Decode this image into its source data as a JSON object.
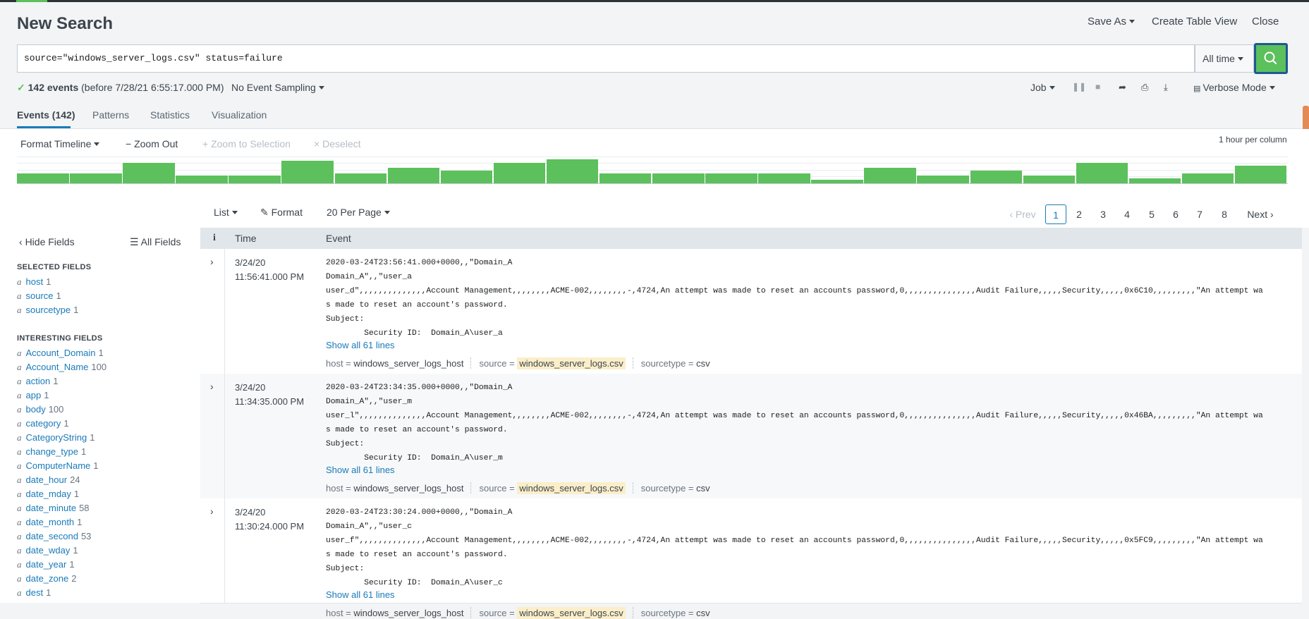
{
  "header": {
    "title": "New Search",
    "save_as": "Save As",
    "create_table_view": "Create Table View",
    "close": "Close"
  },
  "search": {
    "query": "source=\"windows_server_logs.csv\" status=failure",
    "time_range": "All time"
  },
  "status": {
    "events_count": "142 events",
    "before": "(before 7/28/21 6:55:17.000 PM)",
    "sampling": "No Event Sampling",
    "job": "Job",
    "mode": "Verbose Mode"
  },
  "tabs": [
    {
      "label": "Events (142)"
    },
    {
      "label": "Patterns"
    },
    {
      "label": "Statistics"
    },
    {
      "label": "Visualization"
    }
  ],
  "timeline": {
    "format": "Format Timeline",
    "zoom_out": "Zoom Out",
    "zoom_selection": "Zoom to Selection",
    "deselect": "Deselect",
    "scale": "1 hour per column",
    "bar_levels": [
      0.4,
      0.4,
      0.8,
      0.3,
      0.3,
      0.9,
      0.4,
      0.6,
      0.5,
      0.8,
      0.95,
      0.4,
      0.4,
      0.4,
      0.4,
      0.15,
      0.6,
      0.3,
      0.5,
      0.3,
      0.8,
      0.2,
      0.4,
      0.7
    ]
  },
  "results_toolbar": {
    "list": "List",
    "format": "Format",
    "per_page": "20 Per Page",
    "prev": "Prev",
    "next": "Next",
    "pages": [
      "1",
      "2",
      "3",
      "4",
      "5",
      "6",
      "7",
      "8"
    ]
  },
  "sidebar": {
    "hide_fields": "Hide Fields",
    "all_fields": "All Fields",
    "selected_title": "SELECTED FIELDS",
    "selected": [
      {
        "name": "host",
        "count": "1"
      },
      {
        "name": "source",
        "count": "1"
      },
      {
        "name": "sourcetype",
        "count": "1"
      }
    ],
    "interesting_title": "INTERESTING FIELDS",
    "interesting": [
      {
        "name": "Account_Domain",
        "count": "1"
      },
      {
        "name": "Account_Name",
        "count": "100"
      },
      {
        "name": "action",
        "count": "1"
      },
      {
        "name": "app",
        "count": "1"
      },
      {
        "name": "body",
        "count": "100"
      },
      {
        "name": "category",
        "count": "1"
      },
      {
        "name": "CategoryString",
        "count": "1"
      },
      {
        "name": "change_type",
        "count": "1"
      },
      {
        "name": "ComputerName",
        "count": "1"
      },
      {
        "name": "date_hour",
        "count": "24"
      },
      {
        "name": "date_mday",
        "count": "1"
      },
      {
        "name": "date_minute",
        "count": "58"
      },
      {
        "name": "date_month",
        "count": "1"
      },
      {
        "name": "date_second",
        "count": "53"
      },
      {
        "name": "date_wday",
        "count": "1"
      },
      {
        "name": "date_year",
        "count": "1"
      },
      {
        "name": "date_zone",
        "count": "2"
      },
      {
        "name": "dest",
        "count": "1"
      }
    ]
  },
  "events_table": {
    "col_info": "i",
    "col_time": "Time",
    "col_event": "Event",
    "rows": [
      {
        "date": "3/24/20",
        "time": "11:56:41.000 PM",
        "raw": "2020-03-24T23:56:41.000+0000,,\"Domain_A\nDomain_A\",,\"user_a\nuser_d\",,,,,,,,,,,,,,Account Management,,,,,,,,ACME-002,,,,,,,,-,4724,An attempt was made to reset an accounts password,0,,,,,,,,,,,,,,,Audit Failure,,,,,Security,,,,,0x6C10,,,,,,,,,\"An attempt wa\ns made to reset an account's password.\nSubject:\n        Security ID:  Domain_A\\user_a",
        "show": "Show all 61 lines",
        "host": "windows_server_logs_host",
        "source": "windows_server_logs.csv",
        "sourcetype": "csv"
      },
      {
        "date": "3/24/20",
        "time": "11:34:35.000 PM",
        "raw": "2020-03-24T23:34:35.000+0000,,\"Domain_A\nDomain_A\",,\"user_m\nuser_l\",,,,,,,,,,,,,,Account Management,,,,,,,,ACME-002,,,,,,,,-,4724,An attempt was made to reset an accounts password,0,,,,,,,,,,,,,,,Audit Failure,,,,,Security,,,,,0x46BA,,,,,,,,,\"An attempt wa\ns made to reset an account's password.\nSubject:\n        Security ID:  Domain_A\\user_m",
        "show": "Show all 61 lines",
        "host": "windows_server_logs_host",
        "source": "windows_server_logs.csv",
        "sourcetype": "csv"
      },
      {
        "date": "3/24/20",
        "time": "11:30:24.000 PM",
        "raw": "2020-03-24T23:30:24.000+0000,,\"Domain_A\nDomain_A\",,\"user_c\nuser_f\",,,,,,,,,,,,,,Account Management,,,,,,,,ACME-002,,,,,,,,-,4724,An attempt was made to reset an accounts password,0,,,,,,,,,,,,,,,Audit Failure,,,,,Security,,,,,0x5FC9,,,,,,,,,\"An attempt wa\ns made to reset an account's password.\nSubject:\n        Security ID:  Domain_A\\user_c",
        "show": "Show all 61 lines",
        "host": "windows_server_logs_host",
        "source": "windows_server_logs.csv",
        "sourcetype": "csv"
      }
    ],
    "meta_labels": {
      "host": "host = ",
      "source": "source = ",
      "sourcetype": "sourcetype = "
    }
  },
  "colors": {
    "accent_green": "#5cc05c",
    "link_blue": "#1a7ab8",
    "source_highlight": "#fbeec9"
  }
}
